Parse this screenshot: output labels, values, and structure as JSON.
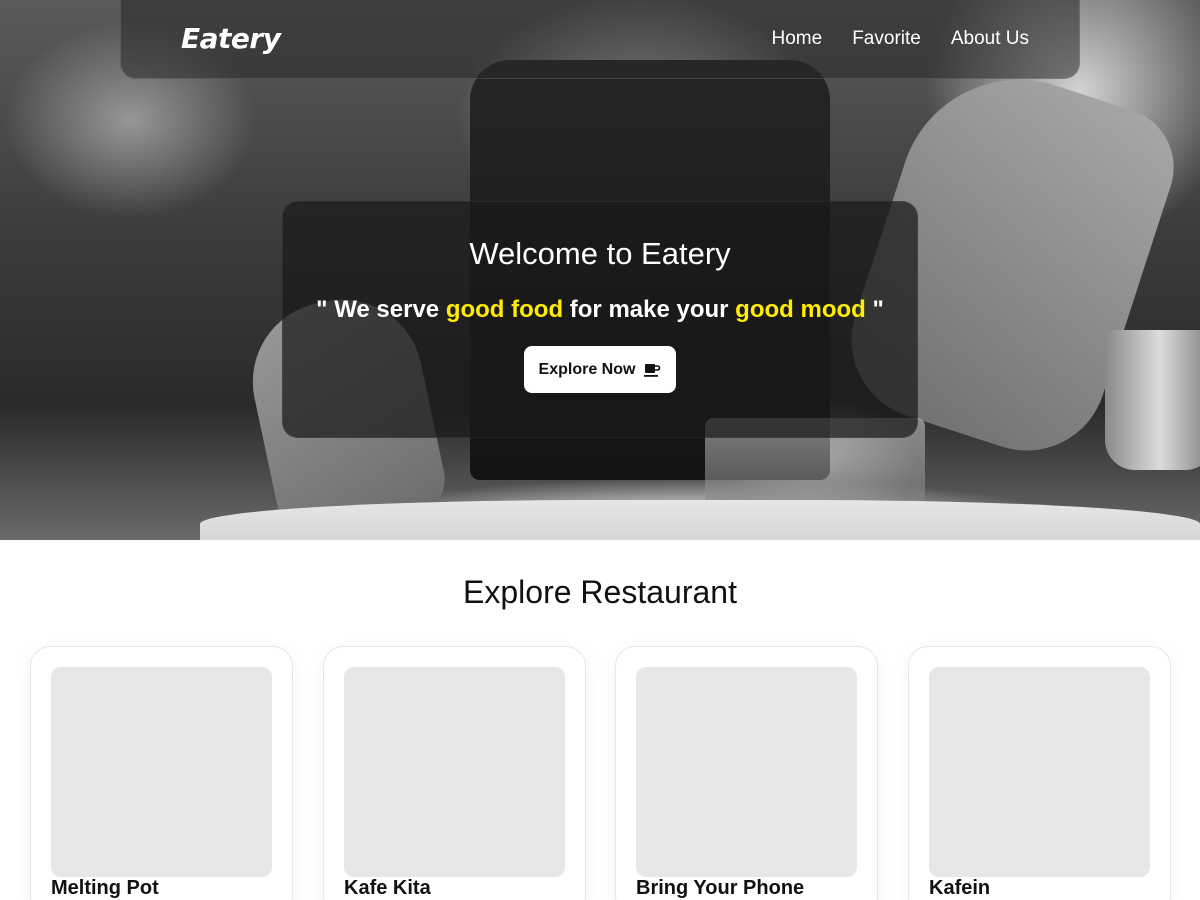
{
  "brand": "Eatery",
  "nav": {
    "items": [
      {
        "label": "Home"
      },
      {
        "label": "Favorite"
      },
      {
        "label": "About Us"
      }
    ]
  },
  "hero": {
    "title": "Welcome to Eatery",
    "tagline": {
      "open_quote": "\" ",
      "part1": "We serve ",
      "highlight1": "good food",
      "part2": " for make your ",
      "highlight2": "good mood",
      "close_quote": " \""
    },
    "button_label": "Explore Now",
    "button_icon": "coffee-cup-icon",
    "highlight_color": "#ffec00"
  },
  "explore": {
    "title": "Explore Restaurant",
    "restaurants": [
      {
        "name": "Melting Pot"
      },
      {
        "name": "Kafe Kita"
      },
      {
        "name": "Bring Your Phone"
      },
      {
        "name": "Kafein"
      }
    ]
  }
}
